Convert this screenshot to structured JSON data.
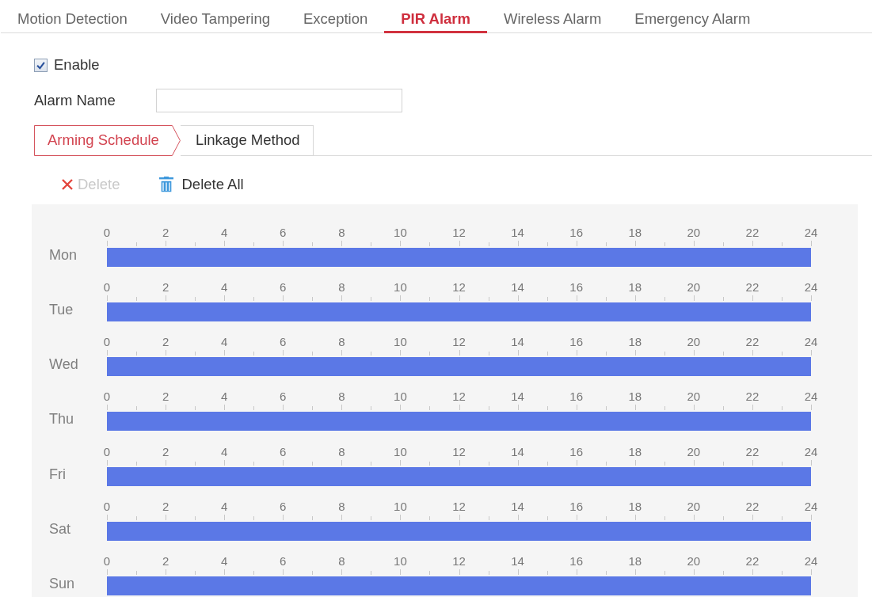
{
  "tabs": [
    {
      "label": "Motion Detection",
      "selected": false
    },
    {
      "label": "Video Tampering",
      "selected": false
    },
    {
      "label": "Exception",
      "selected": false
    },
    {
      "label": "PIR Alarm",
      "selected": true
    },
    {
      "label": "Wireless Alarm",
      "selected": false
    },
    {
      "label": "Emergency Alarm",
      "selected": false
    }
  ],
  "enable": {
    "label": "Enable",
    "checked": true
  },
  "alarm_name": {
    "label": "Alarm Name"
  },
  "subtabs": [
    {
      "label": "Arming Schedule",
      "selected": true
    },
    {
      "label": "Linkage Method",
      "selected": false
    }
  ],
  "toolbar": [
    {
      "kind": "remove",
      "label": "Delete",
      "disabled": true
    },
    {
      "kind": "clear",
      "label": "Delete All",
      "disabled": false
    }
  ],
  "schedule": {
    "chart_data": [
      {
        "type": "bar",
        "orientation": "horizontal",
        "categories": [
          "Mon"
        ],
        "values": [
          24
        ],
        "color": "#5b78e6",
        "xlim": [
          0,
          24
        ],
        "xticks": [
          0,
          2,
          4,
          6,
          8,
          10,
          12,
          14,
          16,
          18,
          20,
          22,
          24
        ]
      },
      {
        "type": "bar",
        "orientation": "horizontal",
        "categories": [
          "Tue"
        ],
        "values": [
          24
        ],
        "color": "#5b78e6",
        "xlim": [
          0,
          24
        ],
        "xticks": [
          0,
          2,
          4,
          6,
          8,
          10,
          12,
          14,
          16,
          18,
          20,
          22,
          24
        ]
      },
      {
        "type": "bar",
        "orientation": "horizontal",
        "categories": [
          "Wed"
        ],
        "values": [
          24
        ],
        "color": "#5b78e6",
        "xlim": [
          0,
          24
        ],
        "xticks": [
          0,
          2,
          4,
          6,
          8,
          10,
          12,
          14,
          16,
          18,
          20,
          22,
          24
        ]
      },
      {
        "type": "bar",
        "orientation": "horizontal",
        "categories": [
          "Thu"
        ],
        "values": [
          24
        ],
        "color": "#5b78e6",
        "xlim": [
          0,
          24
        ],
        "xticks": [
          0,
          2,
          4,
          6,
          8,
          10,
          12,
          14,
          16,
          18,
          20,
          22,
          24
        ]
      },
      {
        "type": "bar",
        "orientation": "horizontal",
        "categories": [
          "Fri"
        ],
        "values": [
          24
        ],
        "color": "#5b78e6",
        "xlim": [
          0,
          24
        ],
        "xticks": [
          0,
          2,
          4,
          6,
          8,
          10,
          12,
          14,
          16,
          18,
          20,
          22,
          24
        ]
      },
      {
        "type": "bar",
        "orientation": "horizontal",
        "categories": [
          "Sat"
        ],
        "values": [
          24
        ],
        "color": "#5b78e6",
        "xlim": [
          0,
          24
        ],
        "xticks": [
          0,
          2,
          4,
          6,
          8,
          10,
          12,
          14,
          16,
          18,
          20,
          22,
          24
        ]
      },
      {
        "type": "bar",
        "orientation": "horizontal",
        "categories": [
          "Sun"
        ],
        "values": [
          24
        ],
        "color": "#5b78e6",
        "xlim": [
          0,
          24
        ],
        "xticks": [
          0,
          2,
          4,
          6,
          8,
          10,
          12,
          14,
          16,
          18,
          20,
          22,
          24
        ]
      }
    ]
  }
}
